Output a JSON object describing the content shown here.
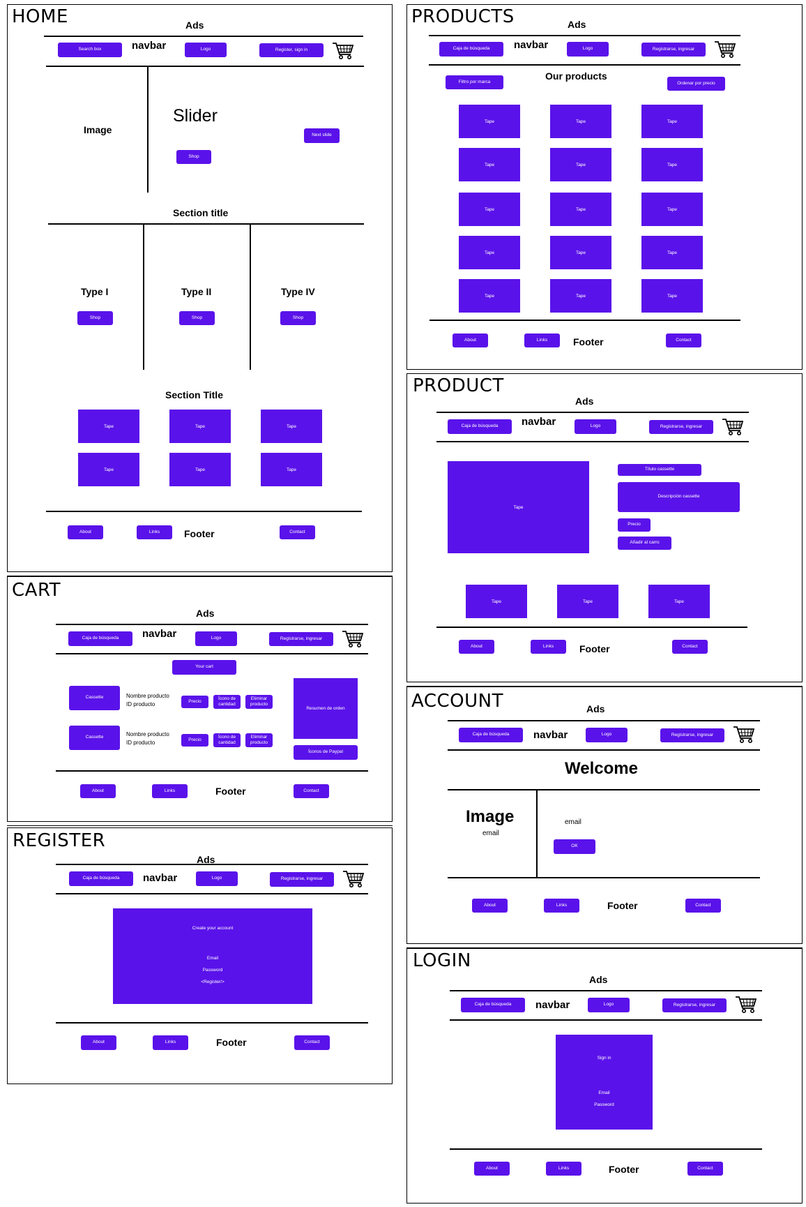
{
  "panels": {
    "home": {
      "title": "HOME",
      "ads": "Ads",
      "navbar": "navbar",
      "search": "Search box",
      "logo": "Logo",
      "register": "Register, sign in",
      "image": "Image",
      "slider": "Slider",
      "shop": "Shop",
      "next_slide": "Next slide",
      "section_title": "Section title",
      "types": [
        "Type I",
        "Type II",
        "Type IV"
      ],
      "section_title2": "Section Title",
      "tape": "Tape",
      "footer": {
        "about": "About",
        "links": "Links",
        "label": "Footer",
        "contact": "Contact"
      }
    },
    "products": {
      "title": "PRODUCTS",
      "ads": "Ads",
      "navbar": "navbar",
      "search": "Caja de búsqueda",
      "logo": "Logo",
      "register": "Registrarse, ingresar",
      "filter": "Filtro por marca",
      "heading": "Our products",
      "sort": "Ordenar por precio",
      "tape": "Tape",
      "footer": {
        "about": "About",
        "links": "Links",
        "label": "Footer",
        "contact": "Contact"
      }
    },
    "product": {
      "title": "PRODUCT",
      "ads": "Ads",
      "navbar": "navbar",
      "search": "Caja de búsqueda",
      "logo": "Logo",
      "register": "Registrarse, ingresar",
      "tape": "Tape",
      "cassette_title": "Título cassette",
      "cassette_desc": "Descripción cassette",
      "price": "Precio",
      "add_to_cart": "Añadir al carro",
      "footer": {
        "about": "About",
        "links": "Links",
        "label": "Footer",
        "contact": "Contact"
      }
    },
    "cart": {
      "title": "CART",
      "ads": "Ads",
      "navbar": "navbar",
      "search": "Caja de búsqueda",
      "logo": "Logo",
      "register": "Registrarse, ingresar",
      "your_cart": "Your cart",
      "cassette": "Cassette",
      "product_name": "Nombre producto",
      "product_id": "ID producto",
      "price": "Precio",
      "qty_icon_1": "Ícono de",
      "qty_icon_2": "cantidad",
      "delete_1": "Eliminar",
      "delete_2": "producto",
      "order_summary": "Resumen de orden",
      "paypal": "Íconos de Paypal",
      "footer": {
        "about": "About",
        "links": "Links",
        "label": "Footer",
        "contact": "Contact"
      }
    },
    "account": {
      "title": "ACCOUNT",
      "ads": "Ads",
      "navbar": "navbar",
      "search": "Caja de búsqueda",
      "logo": "Logo",
      "register": "Registrarse, ingresar",
      "welcome": "Welcome",
      "image": "Image",
      "image_email": "email",
      "email": "email",
      "ok": "OK",
      "footer": {
        "about": "About",
        "links": "Links",
        "label": "Footer",
        "contact": "Contact"
      }
    },
    "register": {
      "title": "REGISTER",
      "ads": "Ads",
      "navbar": "navbar",
      "search": "Caja de búsqueda",
      "logo": "Logo",
      "register": "Registrarse, ingresar",
      "create": "Create your account",
      "email": "Email",
      "password": "Password",
      "register_tag": "<Register/>",
      "footer": {
        "about": "About",
        "links": "Links",
        "label": "Footer",
        "contact": "Contact"
      }
    },
    "login": {
      "title": "LOGIN",
      "ads": "Ads",
      "navbar": "navbar",
      "search": "Caja de búsqueda",
      "logo": "Logo",
      "register": "Registrarse, ingresar",
      "sign_in": "Sign in",
      "email": "Email",
      "password": "Password",
      "footer": {
        "about": "About",
        "links": "Links",
        "label": "Footer",
        "contact": "Contact"
      }
    }
  },
  "colors": {
    "accent": "#5a12ea",
    "line": "#000000",
    "background": "#ffffff"
  }
}
